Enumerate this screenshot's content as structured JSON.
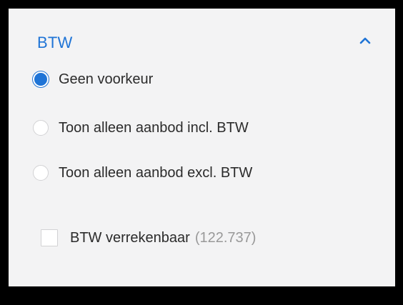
{
  "filter": {
    "title": "BTW",
    "expanded": true,
    "accent_color": "#1f74d6",
    "collapse_icon": "chevron-up-icon",
    "options": [
      {
        "label": "Geen voorkeur",
        "selected": true
      },
      {
        "label": "Toon alleen aanbod incl. BTW",
        "selected": false
      },
      {
        "label": "Toon alleen aanbod excl. BTW",
        "selected": false
      }
    ],
    "checkbox": {
      "label": "BTW verrekenbaar",
      "count": "(122.737)",
      "checked": false
    }
  }
}
